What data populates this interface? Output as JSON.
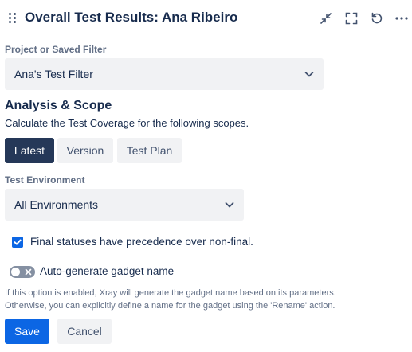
{
  "header": {
    "title": "Overall Test Results: Ana Ribeiro",
    "icons": [
      "drag-handle-icon",
      "minimize-icon",
      "fullscreen-icon",
      "refresh-icon",
      "more-icon"
    ]
  },
  "project_filter": {
    "label": "Project or Saved Filter",
    "value": "Ana's Test Filter"
  },
  "analysis": {
    "heading": "Analysis & Scope",
    "description": "Calculate the Test Coverage for the following scopes.",
    "scopes": [
      {
        "label": "Latest",
        "selected": true
      },
      {
        "label": "Version",
        "selected": false
      },
      {
        "label": "Test Plan",
        "selected": false
      }
    ]
  },
  "environment": {
    "label": "Test Environment",
    "value": "All Environments"
  },
  "final_statuses": {
    "label": "Final statuses have precedence over non-final.",
    "checked": true
  },
  "auto_name": {
    "label": "Auto-generate gadget name",
    "enabled": false,
    "help_line1": "If this option is enabled, Xray will generate the gadget name based on its parameters.",
    "help_line2": "Otherwise, you can explicitly define a name for the gadget using the 'Rename' action."
  },
  "actions": {
    "save": "Save",
    "cancel": "Cancel"
  },
  "colors": {
    "primary": "#0c66e4",
    "selected_segment": "#253858",
    "field_bg": "#f1f2f4"
  }
}
